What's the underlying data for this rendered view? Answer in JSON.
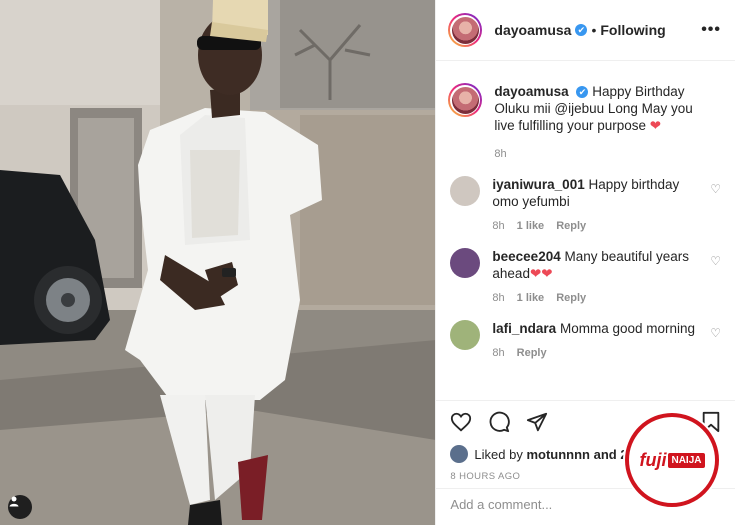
{
  "post": {
    "username": "dayoamusa",
    "verified_mark": "✔",
    "dot": "•",
    "follow_status": "Following",
    "more_icon": "more-horizontal-icon"
  },
  "caption": {
    "username": "dayoamusa",
    "text": "Happy Birthday Oluku mii @ijebuu Long May you live fulfilling your purpose",
    "emoji": "❤",
    "time": "8h"
  },
  "comments": [
    {
      "username": "iyaniwura_001",
      "text": "Happy birthday omo yefumbi",
      "time": "8h",
      "likes": "1 like",
      "reply": "Reply",
      "avatar_color": "#cfc7c0"
    },
    {
      "username": "beecee204",
      "text": "Many beautiful years ahead",
      "emoji": "❤❤",
      "time": "8h",
      "likes": "1 like",
      "reply": "Reply",
      "avatar_color": "#6b4a7e"
    },
    {
      "username": "lafi_ndara",
      "text": "Momma good morning",
      "time": "8h",
      "reply": "Reply",
      "avatar_color": "#9fb37a"
    }
  ],
  "likes": {
    "prefix": "Liked by",
    "user": "motunnnn",
    "suffix": "and 2,941"
  },
  "time_ago": "8 HOURS AGO",
  "add_comment": {
    "placeholder": "Add a comment..."
  },
  "watermark": {
    "left": "fuji",
    "right": "NAIJA"
  },
  "colors": {
    "heart": "#ed4956",
    "verified": "#3897f0",
    "watermark": "#d0141e"
  }
}
